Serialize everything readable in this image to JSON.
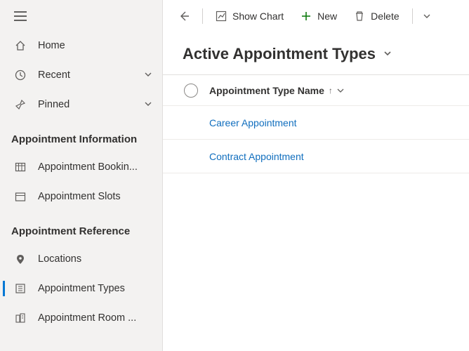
{
  "sidebar": {
    "top": [
      {
        "label": "Home"
      },
      {
        "label": "Recent",
        "expandable": true
      },
      {
        "label": "Pinned",
        "expandable": true
      }
    ],
    "sections": [
      {
        "header": "Appointment Information",
        "items": [
          {
            "label": "Appointment Bookin..."
          },
          {
            "label": "Appointment Slots"
          }
        ]
      },
      {
        "header": "Appointment Reference",
        "items": [
          {
            "label": "Locations"
          },
          {
            "label": "Appointment Types",
            "active": true
          },
          {
            "label": "Appointment Room ..."
          }
        ]
      }
    ]
  },
  "commands": {
    "showChart": "Show Chart",
    "new": "New",
    "delete": "Delete"
  },
  "view": {
    "title": "Active Appointment Types"
  },
  "grid": {
    "columnHeader": "Appointment Type Name",
    "rows": [
      "Career Appointment",
      "Contract Appointment"
    ]
  }
}
